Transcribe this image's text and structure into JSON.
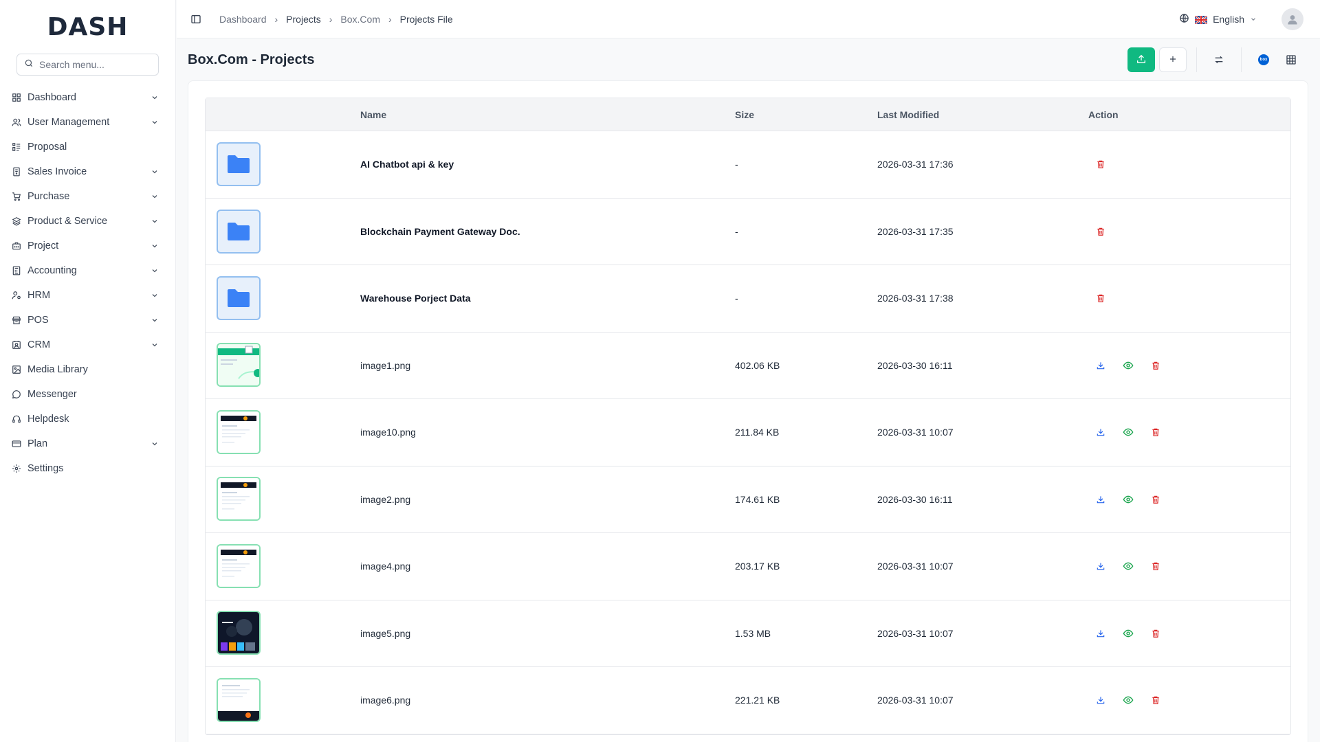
{
  "brand": {
    "logo_text": "DASH"
  },
  "sidebar": {
    "search_placeholder": "Search menu...",
    "items": [
      {
        "label": "Dashboard",
        "icon": "grid-icon",
        "has_children": true
      },
      {
        "label": "User Management",
        "icon": "users-icon",
        "has_children": true
      },
      {
        "label": "Proposal",
        "icon": "proposal-icon",
        "has_children": false
      },
      {
        "label": "Sales Invoice",
        "icon": "invoice-icon",
        "has_children": true
      },
      {
        "label": "Purchase",
        "icon": "cart-icon",
        "has_children": true
      },
      {
        "label": "Product & Service",
        "icon": "layers-icon",
        "has_children": true
      },
      {
        "label": "Project",
        "icon": "briefcase-icon",
        "has_children": true
      },
      {
        "label": "Accounting",
        "icon": "calculator-icon",
        "has_children": true
      },
      {
        "label": "HRM",
        "icon": "user-cog-icon",
        "has_children": true
      },
      {
        "label": "POS",
        "icon": "store-icon",
        "has_children": true
      },
      {
        "label": "CRM",
        "icon": "contact-icon",
        "has_children": true
      },
      {
        "label": "Media Library",
        "icon": "image-icon",
        "has_children": false
      },
      {
        "label": "Messenger",
        "icon": "chat-icon",
        "has_children": false
      },
      {
        "label": "Helpdesk",
        "icon": "headset-icon",
        "has_children": false
      },
      {
        "label": "Plan",
        "icon": "card-icon",
        "has_children": true
      },
      {
        "label": "Settings",
        "icon": "gear-icon",
        "has_children": false
      }
    ]
  },
  "topbar": {
    "breadcrumb": [
      "Dashboard",
      "Projects",
      "Box.Com",
      "Projects File"
    ],
    "language": "English"
  },
  "page": {
    "title": "Box.Com - Projects"
  },
  "table": {
    "headers": {
      "name": "Name",
      "size": "Size",
      "modified": "Last Modified",
      "action": "Action"
    },
    "rows": [
      {
        "type": "folder",
        "name": "AI Chatbot api & key",
        "size": "-",
        "modified": "2026-03-31 17:36"
      },
      {
        "type": "folder",
        "name": "Blockchain Payment Gateway Doc.",
        "size": "-",
        "modified": "2026-03-31 17:35"
      },
      {
        "type": "folder",
        "name": "Warehouse Porject Data",
        "size": "-",
        "modified": "2026-03-31 17:38"
      },
      {
        "type": "image",
        "name": "image1.png",
        "size": "402.06 KB",
        "modified": "2026-03-30 16:11",
        "thumb": "light-green"
      },
      {
        "type": "image",
        "name": "image10.png",
        "size": "211.84 KB",
        "modified": "2026-03-31 10:07",
        "thumb": "light-dark-banner"
      },
      {
        "type": "image",
        "name": "image2.png",
        "size": "174.61 KB",
        "modified": "2026-03-30 16:11",
        "thumb": "light-dark-banner"
      },
      {
        "type": "image",
        "name": "image4.png",
        "size": "203.17 KB",
        "modified": "2026-03-31 10:07",
        "thumb": "light-dark-banner"
      },
      {
        "type": "image",
        "name": "image5.png",
        "size": "1.53 MB",
        "modified": "2026-03-31 10:07",
        "thumb": "dark"
      },
      {
        "type": "image",
        "name": "image6.png",
        "size": "221.21 KB",
        "modified": "2026-03-31 10:07",
        "thumb": "light-dark-footer"
      }
    ]
  },
  "colors": {
    "accent": "#10b981",
    "folder": "#3b82f6",
    "download": "#2563eb",
    "view": "#16a34a",
    "delete": "#dc2626"
  }
}
